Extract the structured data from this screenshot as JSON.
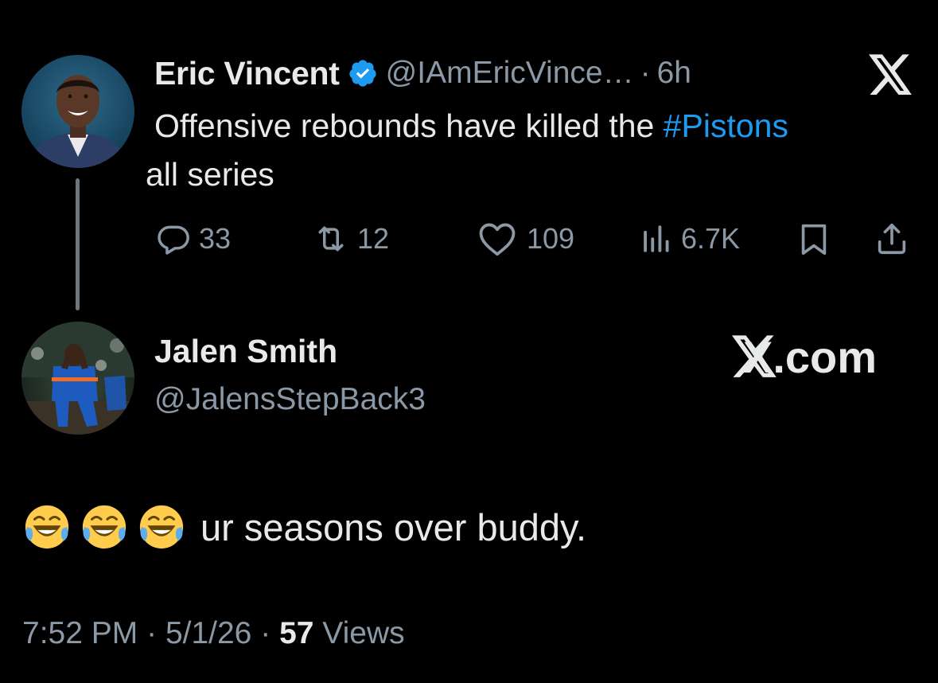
{
  "colors": {
    "background": "#000000",
    "text_primary": "#e7e9ea",
    "text_secondary": "#8b98a5",
    "accent_link": "#1d9bf0",
    "verified_badge": "#1d9bf0",
    "thread_line": "#6e767d"
  },
  "quoted_tweet": {
    "author": {
      "display_name": "Eric Vincent",
      "verified_icon": "verified-badge-icon",
      "handle": "@IAmEricVince…",
      "separator": "·",
      "age": "6h"
    },
    "source_icon": "x-logo-icon",
    "text_before": "Offensive rebounds have killed the ",
    "hashtag": "#Pistons",
    "text_after": " all series",
    "actions": {
      "replies": {
        "icon": "reply-icon",
        "count": "33"
      },
      "reposts": {
        "icon": "repost-icon",
        "count": "12"
      },
      "likes": {
        "icon": "like-icon",
        "count": "109"
      },
      "views": {
        "icon": "views-icon",
        "count": "6.7K"
      },
      "bookmark": {
        "icon": "bookmark-icon"
      },
      "share": {
        "icon": "share-icon"
      }
    }
  },
  "reply": {
    "author": {
      "display_name": "Jalen Smith",
      "handle": "@JalensStepBack3"
    },
    "watermark": "X.com",
    "emojis": [
      "😂",
      "😂",
      "😂"
    ],
    "text": "ur seasons over buddy.",
    "footer": {
      "time": "7:52 PM",
      "sep1": "·",
      "date": "5/1/26",
      "sep2": "·",
      "views_count": "57",
      "views_label": "Views"
    }
  }
}
